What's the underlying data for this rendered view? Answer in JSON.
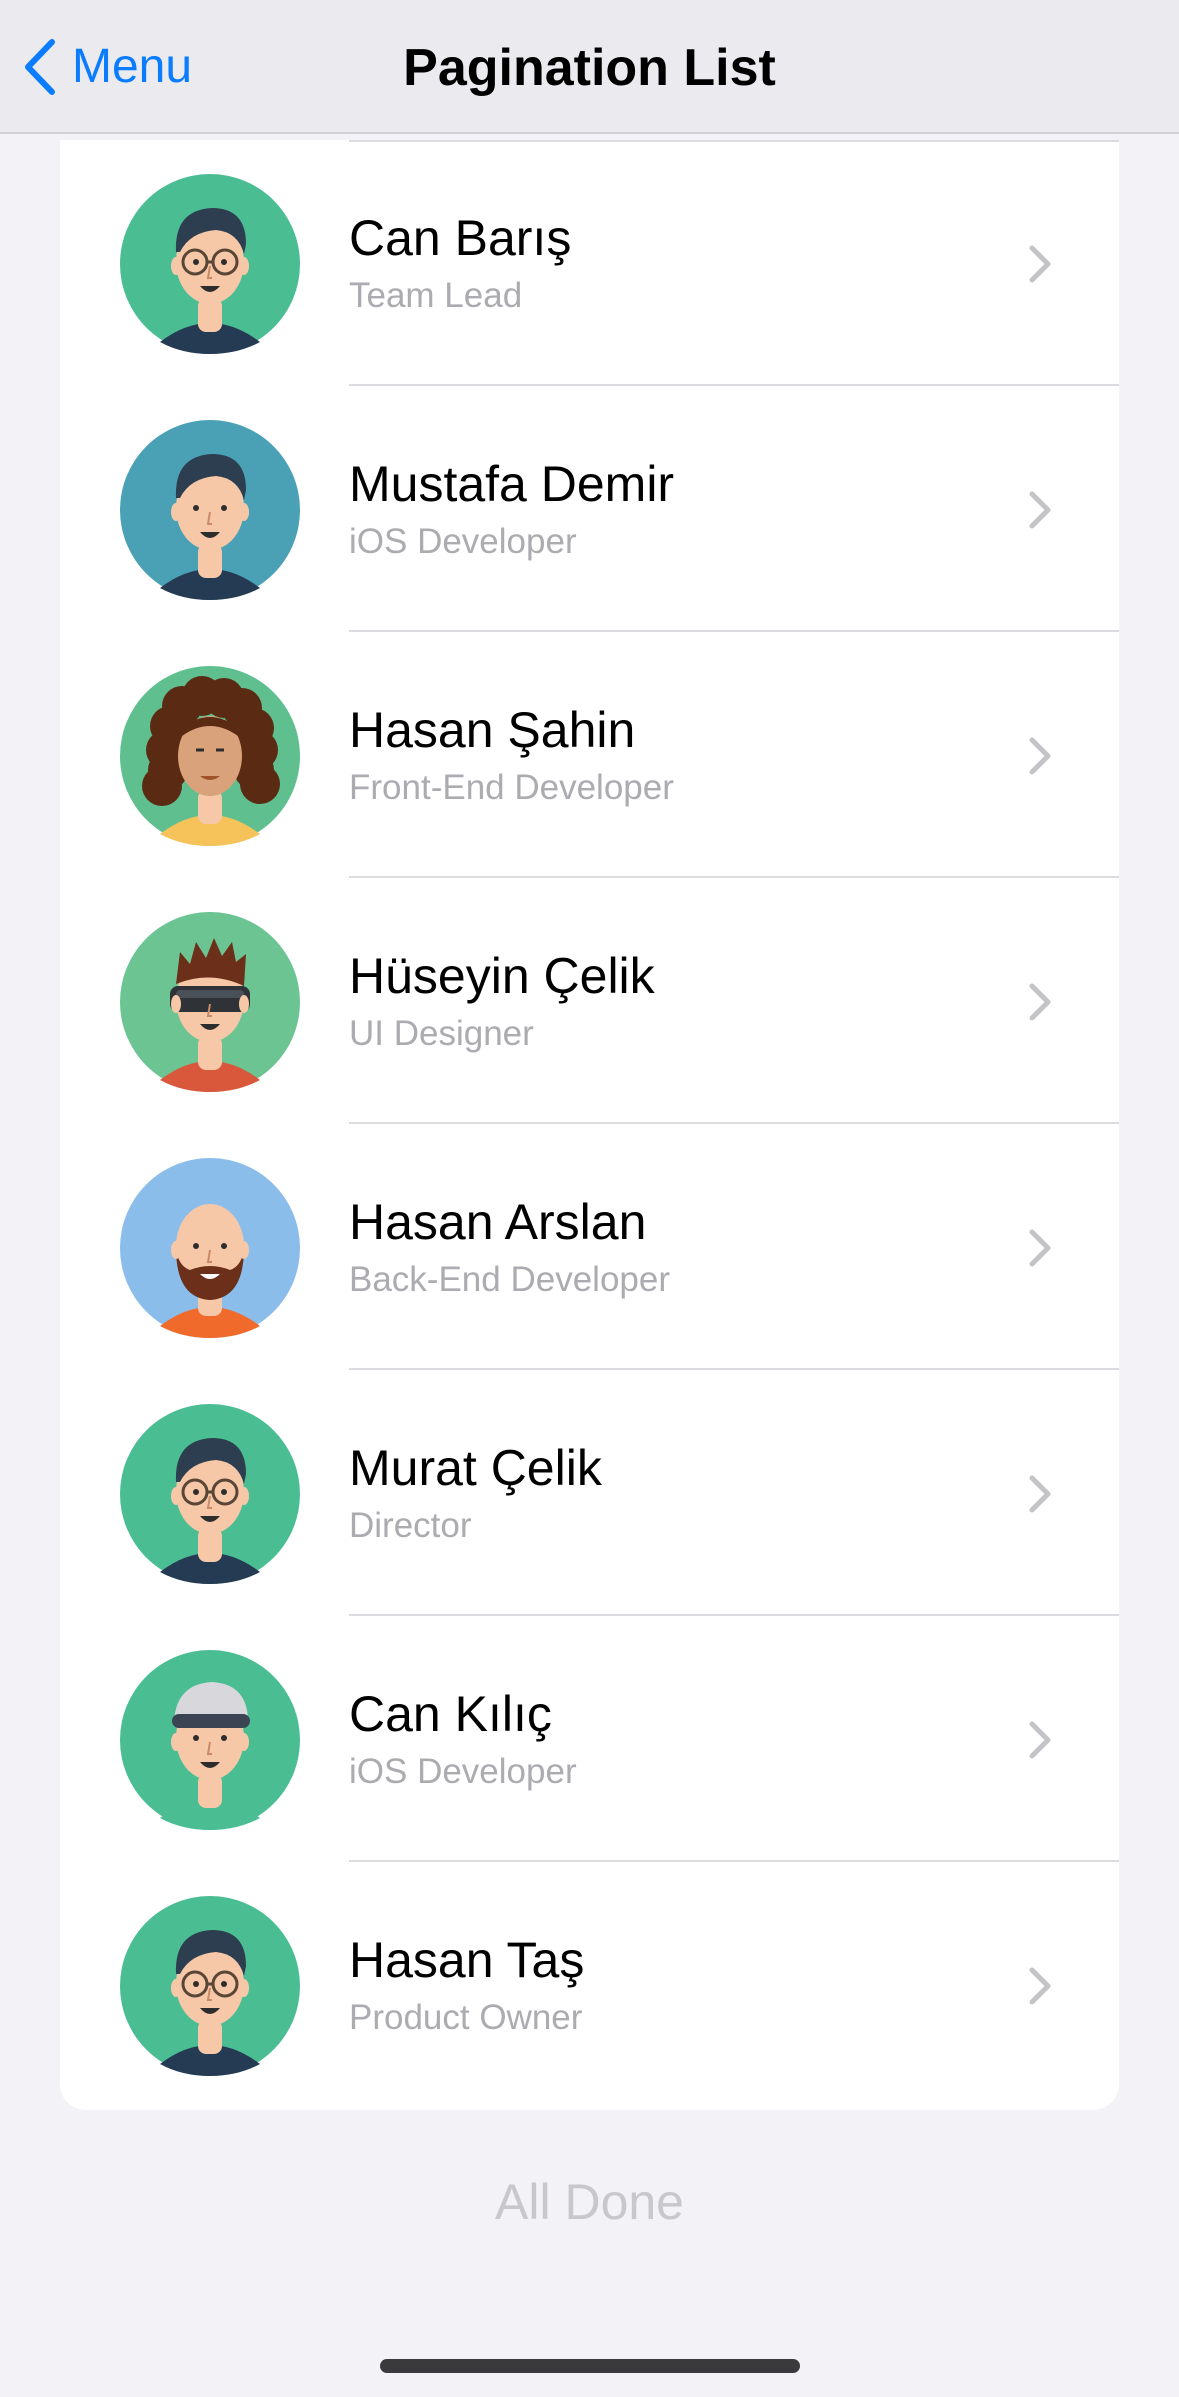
{
  "nav": {
    "back_label": "Menu",
    "title": "Pagination List",
    "accent_color": "#0a7cff"
  },
  "people": [
    {
      "name": "Can Barış",
      "role": "Team Lead",
      "avatar": {
        "style": "glasses-beard-dark-hair",
        "bg": "#4bbd93"
      }
    },
    {
      "name": "Mustafa Demir",
      "role": "iOS Developer",
      "avatar": {
        "style": "dark-hair-smile",
        "bg": "#4aa0b5"
      }
    },
    {
      "name": "Hasan Şahin",
      "role": "Front-End Developer",
      "avatar": {
        "style": "curly-hair",
        "bg": "#5fbf8f"
      }
    },
    {
      "name": "Hüseyin Çelik",
      "role": "UI Designer",
      "avatar": {
        "style": "vr-headset-spiky-hair",
        "bg": "#6cc493"
      }
    },
    {
      "name": "Hasan Arslan",
      "role": "Back-End Developer",
      "avatar": {
        "style": "bald-beard",
        "bg": "#8bbdeb"
      }
    },
    {
      "name": "Murat Çelik",
      "role": "Director",
      "avatar": {
        "style": "glasses-beard-dark-hair",
        "bg": "#4bbd93"
      }
    },
    {
      "name": "Can Kılıç",
      "role": "iOS Developer",
      "avatar": {
        "style": "cap",
        "bg": "#4bbd93"
      }
    },
    {
      "name": "Hasan Taş",
      "role": "Product Owner",
      "avatar": {
        "style": "glasses-beard-dark-hair",
        "bg": "#4bbd93"
      }
    }
  ],
  "footer": {
    "status_text": "All Done"
  }
}
